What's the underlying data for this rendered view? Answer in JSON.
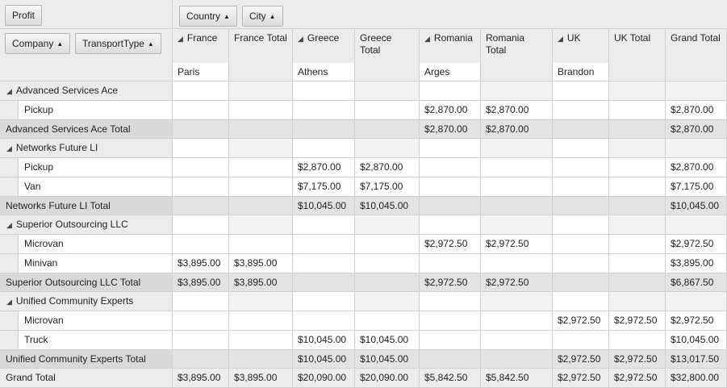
{
  "filter_area": {
    "field": "Profit"
  },
  "column_fields": [
    {
      "label": "Country"
    },
    {
      "label": "City"
    }
  ],
  "row_fields": [
    {
      "label": "Company"
    },
    {
      "label": "TransportType"
    }
  ],
  "sort_glyph": "▲",
  "expand_glyph": "◢",
  "column_headers": [
    {
      "label": "France",
      "expandable": true,
      "sub": "Paris"
    },
    {
      "label": "France Total",
      "expandable": false,
      "sub": ""
    },
    {
      "label": "Greece",
      "expandable": true,
      "sub": "Athens"
    },
    {
      "label": "Greece Total",
      "expandable": false,
      "sub": ""
    },
    {
      "label": "Romania",
      "expandable": true,
      "sub": "Arges"
    },
    {
      "label": "Romania Total",
      "expandable": false,
      "sub": ""
    },
    {
      "label": "UK",
      "expandable": true,
      "sub": "Brandon"
    },
    {
      "label": "UK Total",
      "expandable": false,
      "sub": ""
    },
    {
      "label": "Grand Total",
      "expandable": false,
      "sub": ""
    }
  ],
  "rows": [
    {
      "type": "group",
      "label": "Advanced Services Ace",
      "values": [
        "",
        "",
        "",
        "",
        "",
        "",
        "",
        "",
        ""
      ]
    },
    {
      "type": "item",
      "label": "Pickup",
      "values": [
        "",
        "",
        "",
        "",
        "$2,870.00",
        "$2,870.00",
        "",
        "",
        "$2,870.00"
      ]
    },
    {
      "type": "total",
      "label": "Advanced Services Ace Total",
      "values": [
        "",
        "",
        "",
        "",
        "$2,870.00",
        "$2,870.00",
        "",
        "",
        "$2,870.00"
      ]
    },
    {
      "type": "group",
      "label": "Networks Future LI",
      "values": [
        "",
        "",
        "",
        "",
        "",
        "",
        "",
        "",
        ""
      ]
    },
    {
      "type": "item",
      "label": "Pickup",
      "values": [
        "",
        "",
        "$2,870.00",
        "$2,870.00",
        "",
        "",
        "",
        "",
        "$2,870.00"
      ]
    },
    {
      "type": "item",
      "label": "Van",
      "values": [
        "",
        "",
        "$7,175.00",
        "$7,175.00",
        "",
        "",
        "",
        "",
        "$7,175.00"
      ]
    },
    {
      "type": "total",
      "label": "Networks Future LI Total",
      "values": [
        "",
        "",
        "$10,045.00",
        "$10,045.00",
        "",
        "",
        "",
        "",
        "$10,045.00"
      ]
    },
    {
      "type": "group",
      "label": "Superior Outsourcing LLC",
      "values": [
        "",
        "",
        "",
        "",
        "",
        "",
        "",
        "",
        ""
      ]
    },
    {
      "type": "item",
      "label": "Microvan",
      "values": [
        "",
        "",
        "",
        "",
        "$2,972.50",
        "$2,972.50",
        "",
        "",
        "$2,972.50"
      ]
    },
    {
      "type": "item",
      "label": "Minivan",
      "values": [
        "$3,895.00",
        "$3,895.00",
        "",
        "",
        "",
        "",
        "",
        "",
        "$3,895.00"
      ]
    },
    {
      "type": "total",
      "label": "Superior Outsourcing LLC Total",
      "values": [
        "$3,895.00",
        "$3,895.00",
        "",
        "",
        "$2,972.50",
        "$2,972.50",
        "",
        "",
        "$6,867.50"
      ]
    },
    {
      "type": "group",
      "label": "Unified Community Experts",
      "values": [
        "",
        "",
        "",
        "",
        "",
        "",
        "",
        "",
        ""
      ]
    },
    {
      "type": "item",
      "label": "Microvan",
      "values": [
        "",
        "",
        "",
        "",
        "",
        "",
        "$2,972.50",
        "$2,972.50",
        "$2,972.50"
      ]
    },
    {
      "type": "item",
      "label": "Truck",
      "values": [
        "",
        "",
        "$10,045.00",
        "$10,045.00",
        "",
        "",
        "",
        "",
        "$10,045.00"
      ]
    },
    {
      "type": "total",
      "label": "Unified Community Experts Total",
      "values": [
        "",
        "",
        "$10,045.00",
        "$10,045.00",
        "",
        "",
        "$2,972.50",
        "$2,972.50",
        "$13,017.50"
      ]
    },
    {
      "type": "grand",
      "label": "Grand Total",
      "values": [
        "$3,895.00",
        "$3,895.00",
        "$20,090.00",
        "$20,090.00",
        "$5,842.50",
        "$5,842.50",
        "$2,972.50",
        "$2,972.50",
        "$32,800.00"
      ]
    }
  ]
}
